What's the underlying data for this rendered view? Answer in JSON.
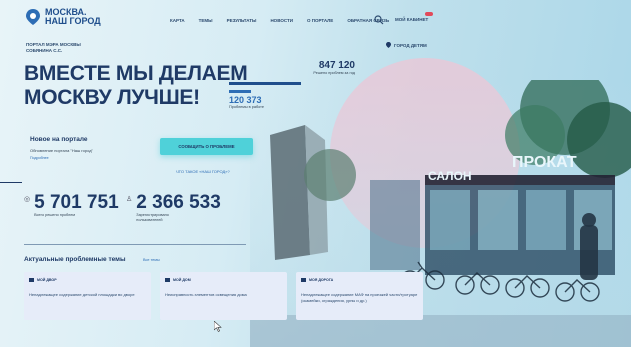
{
  "header": {
    "logo_line1": "МОСКВА.",
    "logo_line2": "НАШ ГОРОД",
    "nav": [
      "КАРТА",
      "ТЕМЫ",
      "РЕЗУЛЬТАТЫ",
      "НОВОСТИ",
      "О ПОРТАЛЕ",
      "ОБРАТНАЯ СВЯЗЬ"
    ],
    "cabinet": "МОЙ КАБИНЕТ",
    "city_link": "ГОРОД ДЕТЯМ"
  },
  "portal": {
    "line1": "ПОРТАЛ МЭРА МОСКВЫ",
    "line2": "СОБЯНИНА С.С."
  },
  "hero": {
    "headline_line1": "ВМЕСТЕ МЫ ДЕЛАЕМ",
    "headline_line2": "МОСКВУ ЛУЧШЕ!",
    "solved_today": "847 120",
    "solved_today_label": "Решено проблем за год",
    "in_work": "120 373",
    "in_work_label": "Проблемы в работе",
    "report_button": "СООБЩИТЬ О ПРОБЛЕМЕ",
    "what_link": "ЧТО ТАКОЕ «НАШ ГОРОД»?"
  },
  "news": {
    "title": "Новое на портале",
    "text": "Обновление портала \"Наш город\"",
    "more": "Подробнее"
  },
  "totals": {
    "solved": "5 701 751",
    "solved_label": "Всего решено проблем",
    "users": "2 366 533",
    "users_label1": "Зарегистрировано",
    "users_label2": "пользователей"
  },
  "topics": {
    "title": "Актуальные проблемные темы",
    "all_link": "Все темы",
    "cards": [
      {
        "category": "МОЙ ДВОР",
        "text": "Ненадлежащее содержание детской площадки во дворе"
      },
      {
        "category": "МОЙ ДОМ",
        "text": "Неисправность элементов освещения дома"
      },
      {
        "category": "МОЯ ДОРОГА",
        "text": "Ненадлежащее содержание МАФ на проезжей части/тротуаре (скамейки, ограждения, урны и др.)"
      }
    ]
  },
  "scene": {
    "kiosk_left": "САЛОН",
    "kiosk_right": "ПРОКАТ"
  },
  "colors": {
    "accent": "#4fd1d9",
    "brand": "#1f3a66",
    "badge": "#e24a5a"
  }
}
